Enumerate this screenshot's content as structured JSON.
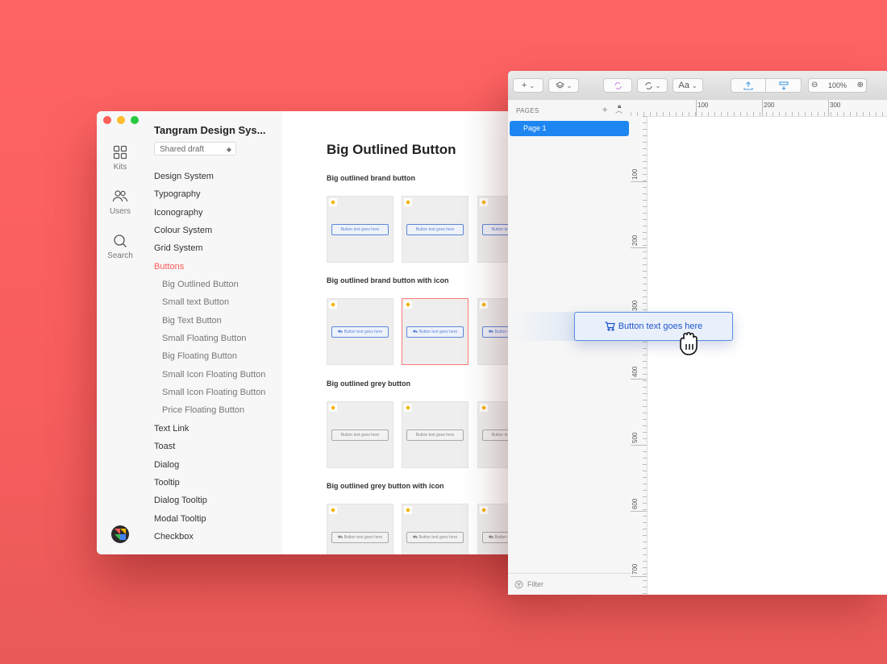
{
  "library": {
    "title": "Tangram Design Sys...",
    "draft": "Shared draft",
    "rail": [
      {
        "label": "Kits",
        "icon": "grid-icon"
      },
      {
        "label": "Users",
        "icon": "users-icon"
      },
      {
        "label": "Search",
        "icon": "search-icon"
      }
    ],
    "nav": [
      {
        "label": "Design System",
        "level": 0
      },
      {
        "label": "Typography",
        "level": 0
      },
      {
        "label": "Iconography",
        "level": 0
      },
      {
        "label": "Colour System",
        "level": 0
      },
      {
        "label": "Grid System",
        "level": 0
      },
      {
        "label": "Buttons",
        "level": 0,
        "active": true
      },
      {
        "label": "Big Outlined Button",
        "level": 1
      },
      {
        "label": "Small text Button",
        "level": 1
      },
      {
        "label": "Big Text Button",
        "level": 1
      },
      {
        "label": "Small Floating Button",
        "level": 1
      },
      {
        "label": "Big Floating Button",
        "level": 1
      },
      {
        "label": "Small Icon Floating Button",
        "level": 1
      },
      {
        "label": "Small Icon Floating Button",
        "level": 1
      },
      {
        "label": "Price Floating Button",
        "level": 1
      },
      {
        "label": "Text Link",
        "level": 0
      },
      {
        "label": "Toast",
        "level": 0
      },
      {
        "label": "Dialog",
        "level": 0
      },
      {
        "label": "Tooltip",
        "level": 0
      },
      {
        "label": "Dialog Tooltip",
        "level": 0
      },
      {
        "label": "Modal Tooltip",
        "level": 0
      },
      {
        "label": "Checkbox",
        "level": 0
      }
    ],
    "main": {
      "heading": "Big Outlined Button",
      "sections": [
        {
          "label": "Big outlined brand button",
          "btn": "Button text goes here",
          "variant": "brand",
          "icon": false
        },
        {
          "label": "Big outlined brand button with icon",
          "btn": "Button text goes here",
          "variant": "brand",
          "icon": true
        },
        {
          "label": "Big outlined grey button",
          "btn": "Button text goes here",
          "variant": "grey",
          "icon": false
        },
        {
          "label": "Big outlined grey button with icon",
          "btn": "Button text goes here",
          "variant": "grey",
          "icon": true
        }
      ]
    }
  },
  "sketch": {
    "pages_label": "PAGES",
    "page_item": "Page 1",
    "filter": "Filter",
    "zoom": "100%",
    "font_btn": "Aa",
    "ruler_top": [
      "100",
      "200",
      "300"
    ],
    "ruler_left": [
      "100",
      "200",
      "300",
      "400",
      "500",
      "600",
      "700"
    ]
  },
  "dragged": {
    "label": "Button text goes here"
  },
  "colors": {
    "background": "#ff6464",
    "accent_red": "#ff5b5b",
    "brand_blue": "#1f55c8",
    "page_selected": "#1e86f0"
  }
}
